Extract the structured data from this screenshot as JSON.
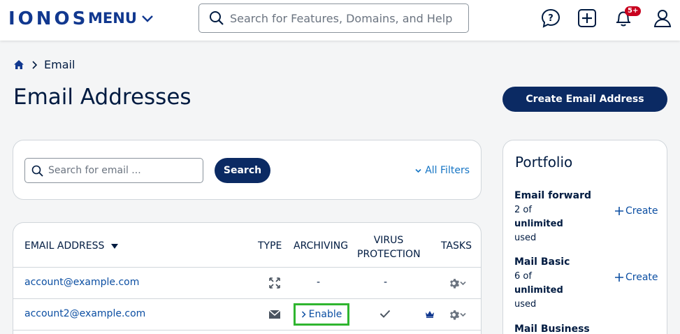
{
  "header": {
    "logo": "IONOS",
    "menu_label": "MENU",
    "search_placeholder": "Search for Features, Domains, and Help",
    "notification_badge": "5+"
  },
  "breadcrumb": {
    "current": "Email"
  },
  "page": {
    "title": "Email Addresses",
    "create_button": "Create Email Address"
  },
  "search": {
    "placeholder": "Search for email ...",
    "button": "Search",
    "filters": "All Filters"
  },
  "table": {
    "headers": {
      "email": "EMAIL ADDRESS",
      "type": "TYPE",
      "archiving": "ARCHIVING",
      "virus_line1": "VIRUS",
      "virus_line2": "PROTECTION",
      "tasks": "TASKS"
    },
    "rows": [
      {
        "email": "account@example.com",
        "type_icon": "forward-icon",
        "archiving": "-",
        "virus": "-"
      },
      {
        "email": "account2@example.com",
        "type_icon": "mail-icon",
        "archiving": "Enable",
        "virus_icon": "check-icon"
      }
    ]
  },
  "portfolio": {
    "title": "Portfolio",
    "create_label": "Create",
    "items": [
      {
        "name": "Email forward",
        "count": "2 of",
        "limit": "unlimited",
        "suffix": "used"
      },
      {
        "name": "Mail Basic",
        "count": "6 of",
        "limit": "unlimited",
        "suffix": "used"
      },
      {
        "name": "Mail Business"
      }
    ]
  },
  "colors": {
    "brand": "#11388f",
    "primary_button": "#0b2a63",
    "link": "#0b4ea2",
    "highlight": "#2fb52f",
    "badge": "#c8001e"
  }
}
